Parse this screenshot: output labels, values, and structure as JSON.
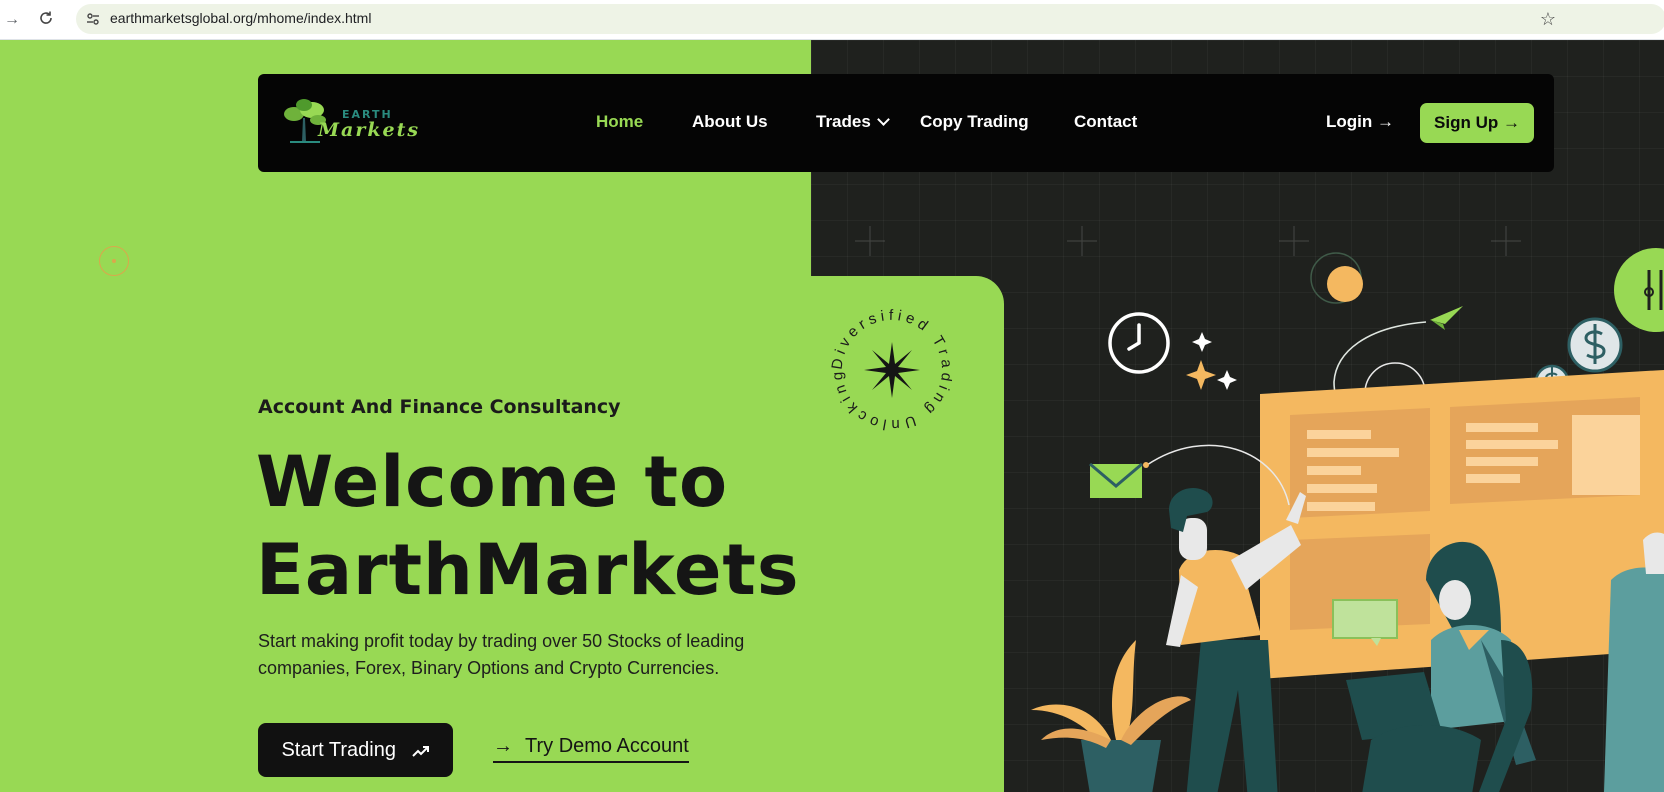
{
  "browser": {
    "url": "earthmarketsglobal.org/mhome/index.html",
    "back_icon": "arrow-right-icon",
    "reload_icon": "reload-icon",
    "bookmark_icon": "star-icon"
  },
  "logo": {
    "line1": "EARTH",
    "line2": "Markets"
  },
  "nav": {
    "items": [
      "Home",
      "About Us",
      "Trades",
      "Copy Trading",
      "Contact"
    ],
    "active": "Home",
    "login": "Login →",
    "signup": "Sign Up →"
  },
  "hero": {
    "eyebrow": "Account And Finance Consultancy",
    "headline_line1": "Welcome to",
    "headline_line2": "EarthMarkets",
    "subtext": "Start making profit today by trading over 50 Stocks of leading companies, Forex, Binary Options and Crypto Currencies.",
    "start_button": "Start Trading",
    "demo_button": "Try Demo Account",
    "badge_text": "Diversified Trading Unlocking"
  },
  "colors": {
    "accent": "#98d954",
    "dark": "#1f211e",
    "orange": "#f4b860",
    "teal": "#2d5f63"
  }
}
